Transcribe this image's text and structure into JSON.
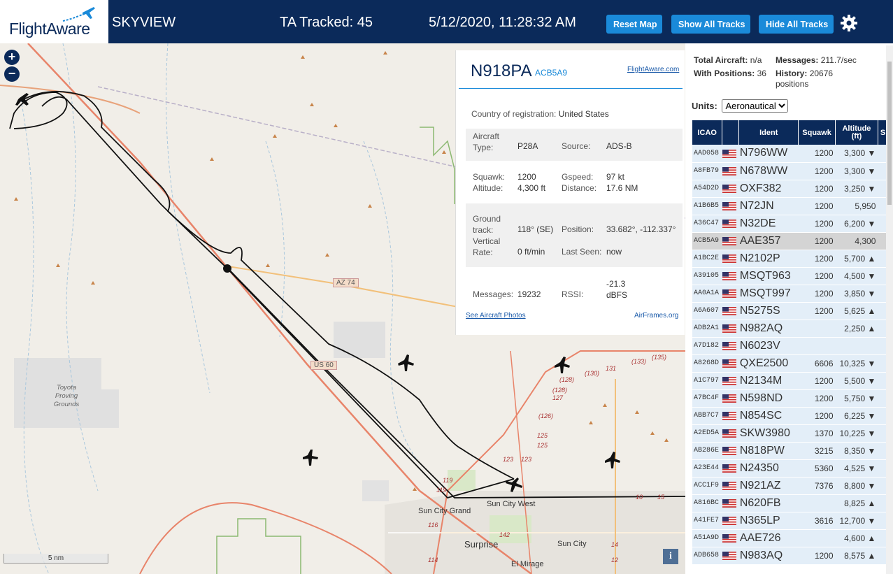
{
  "header": {
    "logo_text": "FlightAware",
    "app_title": "SKYVIEW",
    "tracked_label": "TA Tracked: 45",
    "datetime": "5/12/2020, 11:28:32 AM",
    "buttons": {
      "reset": "Reset Map",
      "show": "Show All Tracks",
      "hide": "Hide All Tracks"
    },
    "brand_color": "#0b2a5a",
    "accent_color": "#1a8ad9"
  },
  "map": {
    "zoom_in": "+",
    "zoom_out": "−",
    "scale": "5 nm",
    "info": "i",
    "labels": {
      "toyota": "Toyota Proving Grounds",
      "az74": "AZ 74",
      "us60": "US 60",
      "sun_city_west": "Sun City West",
      "sun_city_grand": "Sun City Grand",
      "surprise": "Surprise",
      "sun_city": "Sun City",
      "el_mirage": "El Mirage",
      "r123a": "123",
      "r123b": "123",
      "r125a": "125",
      "r125b": "125",
      "r126": "(126)",
      "r127": "127",
      "r128a": "(128)",
      "r128b": "(128)",
      "r130": "(130)",
      "r131": "131",
      "r133": "(133)",
      "r135": "(135)",
      "r119a": "119",
      "r119b": "119",
      "r116": "116",
      "r114": "114",
      "r142": "142",
      "r14": "14",
      "r12": "12",
      "r10": "10",
      "r15": "15"
    }
  },
  "popup": {
    "registration": "N918PA",
    "hex": "ACB5A9",
    "flightaware_link": "FlightAware.com",
    "country_label": "Country of registration:",
    "country": "United States",
    "aircraft_type_label": "Aircraft Type:",
    "aircraft_type": "P28A",
    "source_label": "Source:",
    "source": "ADS-B",
    "squawk_label": "Squawk:",
    "squawk": "1200",
    "gspeed_label": "Gspeed:",
    "gspeed": "97 kt",
    "altitude_label": "Altitude:",
    "altitude": "4,300 ft",
    "distance_label": "Distance:",
    "distance": "17.6 NM",
    "ground_track_label": "Ground track:",
    "ground_track": "118° (SE)",
    "position_label": "Position:",
    "position": "33.682°, -112.337°",
    "vertical_rate_label": "Vertical Rate:",
    "vertical_rate": "0 ft/min",
    "last_seen_label": "Last Seen:",
    "last_seen": "now",
    "messages_label": "Messages:",
    "messages": "19232",
    "rssi_label": "RSSI:",
    "rssi": "-21.3 dBFS",
    "photos_link": "See Aircraft Photos",
    "airframes_link": "AirFrames.org"
  },
  "panel": {
    "total_aircraft_label": "Total Aircraft:",
    "total_aircraft": "n/a",
    "messages_label": "Messages:",
    "messages": "211.7/sec",
    "with_positions_label": "With Positions:",
    "with_positions": "36",
    "history_label": "History:",
    "history": "20676 positions",
    "units_label": "Units:",
    "units_value": "Aeronautical",
    "columns": [
      "ICAO",
      "",
      "Ident",
      "Squawk",
      "Altitude (ft)",
      "Sp"
    ],
    "rows": [
      {
        "icao": "AAD058",
        "ident": "N796WW",
        "squawk": "1200",
        "altitude": "3,300 ▼"
      },
      {
        "icao": "A8FB79",
        "ident": "N678WW",
        "squawk": "1200",
        "altitude": "3,300 ▼"
      },
      {
        "icao": "A54D2D",
        "ident": "OXF382",
        "squawk": "1200",
        "altitude": "3,250 ▼"
      },
      {
        "icao": "A1B6B5",
        "ident": "N72JN",
        "squawk": "1200",
        "altitude": "5,950"
      },
      {
        "icao": "A36C47",
        "ident": "N32DE",
        "squawk": "1200",
        "altitude": "6,200 ▼"
      },
      {
        "icao": "ACB5A9",
        "ident": "AAE357",
        "squawk": "1200",
        "altitude": "4,300",
        "selected": true
      },
      {
        "icao": "A1BC2E",
        "ident": "N2102P",
        "squawk": "1200",
        "altitude": "5,700 ▲"
      },
      {
        "icao": "A39105",
        "ident": "MSQT963",
        "squawk": "1200",
        "altitude": "4,500 ▼"
      },
      {
        "icao": "AA0A1A",
        "ident": "MSQT997",
        "squawk": "1200",
        "altitude": "3,850 ▼"
      },
      {
        "icao": "A6A607",
        "ident": "N5275S",
        "squawk": "1200",
        "altitude": "5,625 ▲"
      },
      {
        "icao": "ADB2A1",
        "ident": "N982AQ",
        "squawk": "",
        "altitude": "2,250 ▲"
      },
      {
        "icao": "A7D182",
        "ident": "N6023V",
        "squawk": "",
        "altitude": ""
      },
      {
        "icao": "A8268D",
        "ident": "QXE2500",
        "squawk": "6606",
        "altitude": "10,325 ▼"
      },
      {
        "icao": "A1C797",
        "ident": "N2134M",
        "squawk": "1200",
        "altitude": "5,500 ▼"
      },
      {
        "icao": "A7BC4F",
        "ident": "N598ND",
        "squawk": "1200",
        "altitude": "5,750 ▼"
      },
      {
        "icao": "ABB7C7",
        "ident": "N854SC",
        "squawk": "1200",
        "altitude": "6,225 ▼"
      },
      {
        "icao": "A2ED5A",
        "ident": "SKW3980",
        "squawk": "1370",
        "altitude": "10,225 ▼"
      },
      {
        "icao": "AB286E",
        "ident": "N818PW",
        "squawk": "3215",
        "altitude": "8,350 ▼"
      },
      {
        "icao": "A23E44",
        "ident": "N24350",
        "squawk": "5360",
        "altitude": "4,525 ▼"
      },
      {
        "icao": "ACC1F9",
        "ident": "N921AZ",
        "squawk": "7376",
        "altitude": "8,800 ▼"
      },
      {
        "icao": "A816BC",
        "ident": "N620FB",
        "squawk": "",
        "altitude": "8,825 ▲"
      },
      {
        "icao": "A41FE7",
        "ident": "N365LP",
        "squawk": "3616",
        "altitude": "12,700 ▼"
      },
      {
        "icao": "A51A9D",
        "ident": "AAE726",
        "squawk": "",
        "altitude": "4,600 ▲"
      },
      {
        "icao": "ADB658",
        "ident": "N983AQ",
        "squawk": "1200",
        "altitude": "8,575 ▲"
      }
    ]
  }
}
